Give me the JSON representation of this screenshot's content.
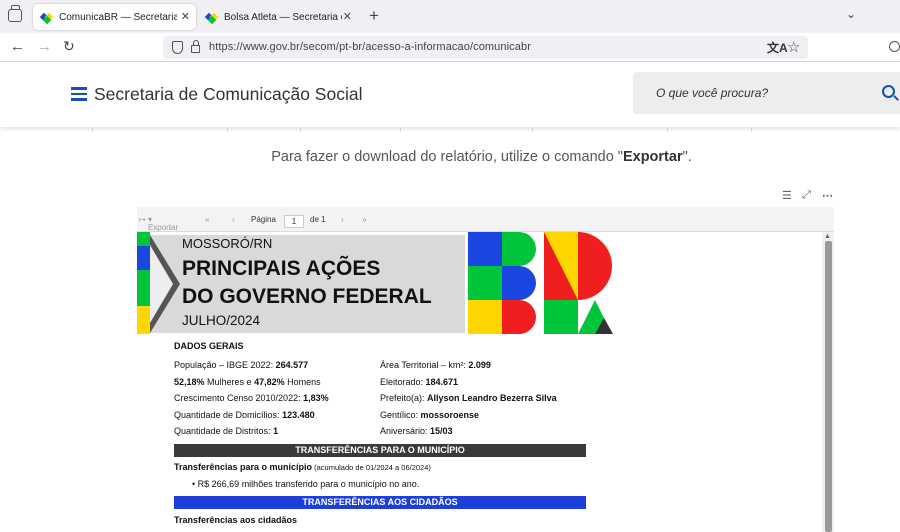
{
  "browser": {
    "tabs": [
      {
        "title": "ComunicaBR — Secretaria de C",
        "active": true
      },
      {
        "title": "Bolsa Atleta — Secretaria de Co",
        "active": false
      }
    ],
    "new_tab": "+",
    "url": "https://www.gov.br/secom/pt-br/acesso-a-informacao/comunicabr"
  },
  "site": {
    "title": "Secretaria de Comunicação Social",
    "search_placeholder": "O que você procura?"
  },
  "instruction": {
    "before": "Para fazer o download do relatório, utilize o comando \"",
    "command": "Exportar",
    "after": "\"."
  },
  "report_toolbar": {
    "export": "Exportar",
    "page_label": "Página",
    "page_value": "1",
    "of_label": "de 1"
  },
  "report": {
    "city": "MOSSORÓ/RN",
    "headline_1": "PRINCIPAIS AÇÕES",
    "headline_2": "DO GOVERNO FEDERAL",
    "month": "JULHO/2024",
    "section": "DADOS GERAIS",
    "left": [
      {
        "label": "População – IBGE 2022: ",
        "value": "264.577"
      },
      {
        "pre": "52,18%",
        "mid": " Mulheres e ",
        "value": "47,82%",
        "post": " Homens"
      },
      {
        "label": "Crescimento Censo 2010/2022: ",
        "value": "1,83%"
      },
      {
        "label": "Quantidade de Domicílios: ",
        "value": "123.480"
      },
      {
        "label": "Quantidade de Distritos: ",
        "value": "1"
      }
    ],
    "right": [
      {
        "label": "Área Territorial – km²: ",
        "value": "2.099"
      },
      {
        "label": "Eleitorado: ",
        "value": "184.671"
      },
      {
        "label": "Prefeito(a): ",
        "value": "Allyson Leandro Bezerra Silva"
      },
      {
        "label": "Gentílico: ",
        "value": "mossoroense"
      },
      {
        "label": "Aniversário: ",
        "value": "15/03"
      }
    ],
    "bar_municipio": "TRANSFERÊNCIAS PARA O MUNICÍPIO",
    "transfer_title": "Transferências para o município",
    "transfer_period": " (acumulado de 01/2024 a 06/2024)",
    "transfer_bullet": "R$ 266,69 milhões transferido para o município no ano.",
    "bar_cidadaos": "TRANSFERÊNCIAS AOS CIDADÃOS",
    "citizens_title": "Transferências aos cidadãos"
  },
  "colors": {
    "gov_blue": "#1351b4",
    "bar_dark": "#3a3a3a",
    "bar_blue": "#1b3fd8",
    "br_green": "#00c53a",
    "br_yellow": "#ffd600",
    "br_red": "#f01e1e",
    "br_blue": "#1a47e0"
  }
}
